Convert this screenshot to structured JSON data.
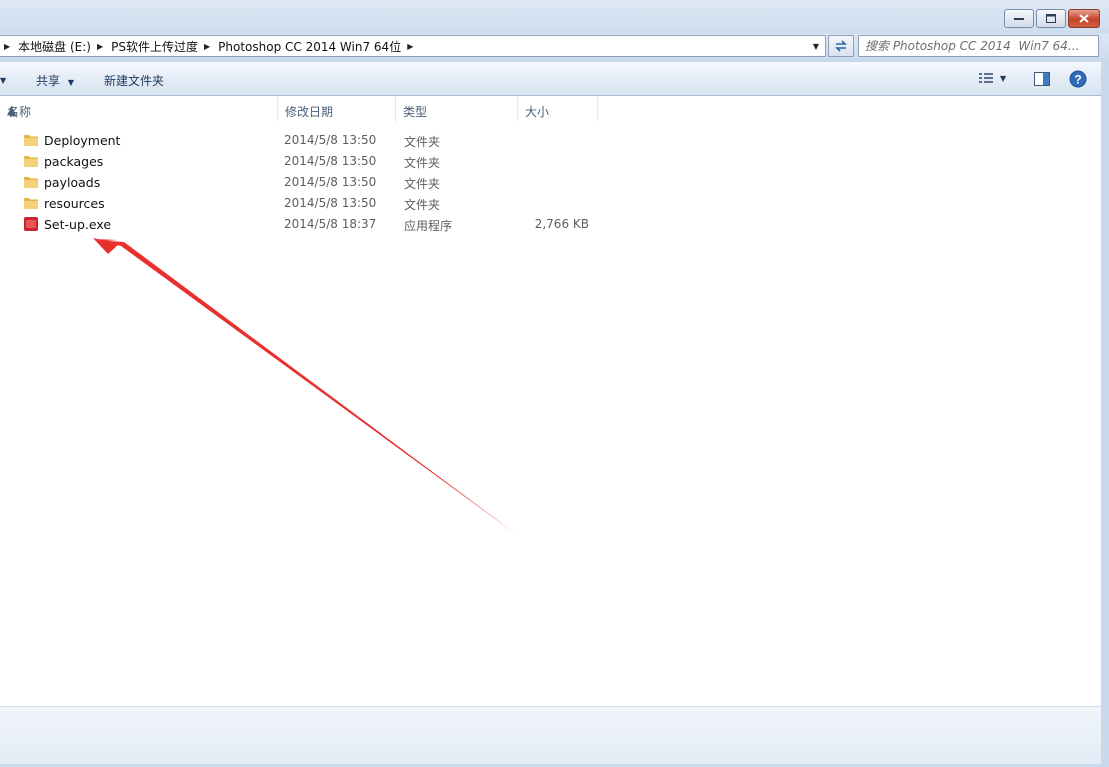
{
  "window": {
    "minimize_glyph": "—",
    "maximize_glyph": "□",
    "close_glyph": "✕"
  },
  "address": {
    "breadcrumbs": [
      "本地磁盘 (E:)",
      "PS软件上传过度",
      "Photoshop CC 2014  Win7 64位"
    ]
  },
  "search": {
    "placeholder": "搜索 Photoshop CC 2014  Win7 64..."
  },
  "toolbar": {
    "share_label": "共享",
    "new_folder_label": "新建文件夹"
  },
  "columns": {
    "name": "名称",
    "date": "修改日期",
    "type": "类型",
    "size": "大小"
  },
  "files": [
    {
      "name": "Deployment",
      "date": "2014/5/8 13:50",
      "type": "文件夹",
      "size": "",
      "icon": "folder-icon"
    },
    {
      "name": "packages",
      "date": "2014/5/8 13:50",
      "type": "文件夹",
      "size": "",
      "icon": "folder-icon"
    },
    {
      "name": "payloads",
      "date": "2014/5/8 13:50",
      "type": "文件夹",
      "size": "",
      "icon": "folder-icon"
    },
    {
      "name": "resources",
      "date": "2014/5/8 13:50",
      "type": "文件夹",
      "size": "",
      "icon": "folder-icon"
    },
    {
      "name": "Set-up.exe",
      "date": "2014/5/8 18:37",
      "type": "应用程序",
      "size": "2,766 KB",
      "icon": "adobe-setup-icon"
    }
  ],
  "colors": {
    "folder": "#e8c25a",
    "exe": "#c8232d",
    "annotation_arrow": "#e8302e"
  }
}
